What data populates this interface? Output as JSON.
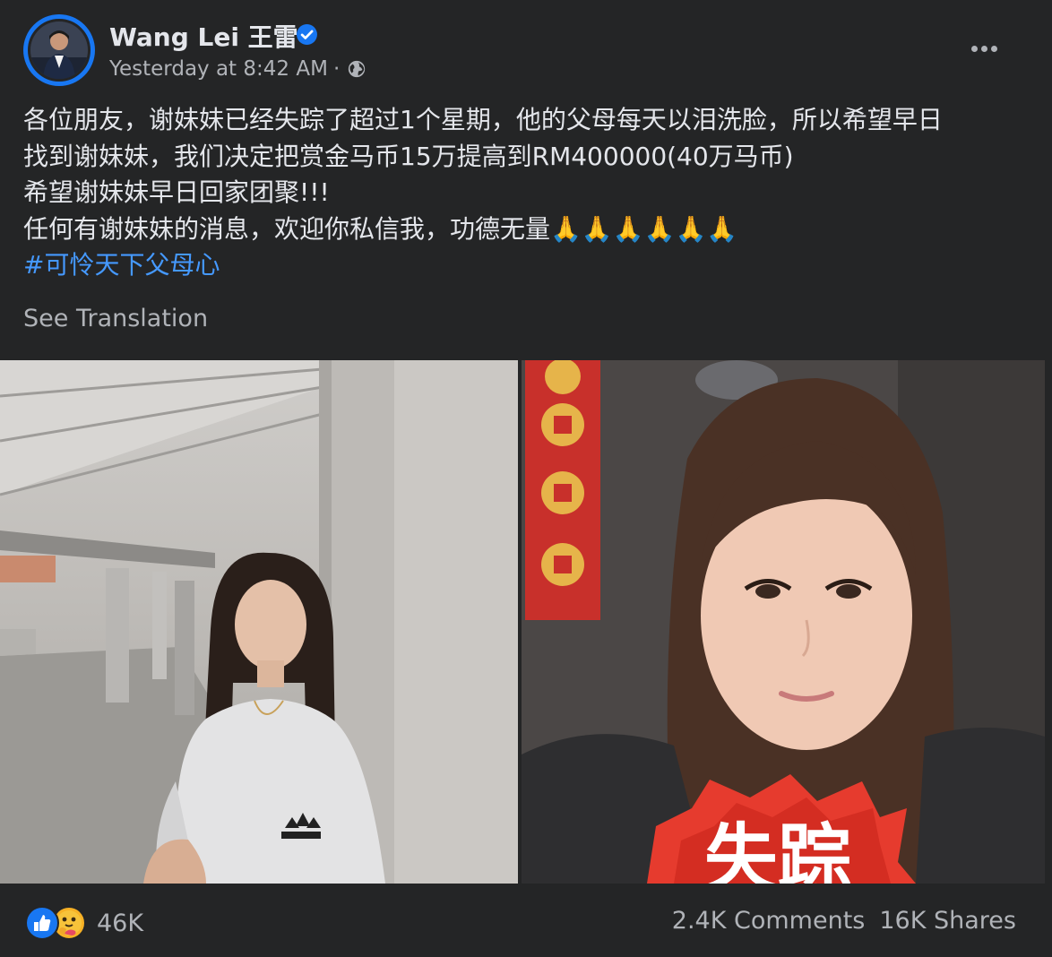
{
  "post": {
    "author": "Wang Lei 王雷",
    "timestamp": "Yesterday at 8:42 AM",
    "separator": "·",
    "privacy_icon": "globe-icon",
    "verified_icon": "verified-badge-icon",
    "body_lines": [
      "各位朋友，谢妹妹已经失踪了超过1个星期，他的父母每天以泪洗脸，所以希望早日",
      "找到谢妹妹，我们决定把赏金马币15万提高到RM400000(40万马币)",
      "希望谢妹妹早日回家团聚!!!",
      "任何有谢妹妹的消息，欢迎你私信我，功德无量🙏🙏🙏🙏🙏🙏"
    ],
    "hashtag": "#可怜天下父母心",
    "see_translation": "See Translation"
  },
  "photos": {
    "right_banner_text": "失踪"
  },
  "footer": {
    "reaction_icons": [
      "like-icon",
      "care-icon"
    ],
    "reaction_count": "46K",
    "comments": "2.4K Comments",
    "shares": "16K Shares"
  },
  "colors": {
    "background": "#242526",
    "primary_text": "#e4e6eb",
    "secondary_text": "#b0b3b8",
    "link": "#4599ff",
    "accent": "#1877f2"
  }
}
